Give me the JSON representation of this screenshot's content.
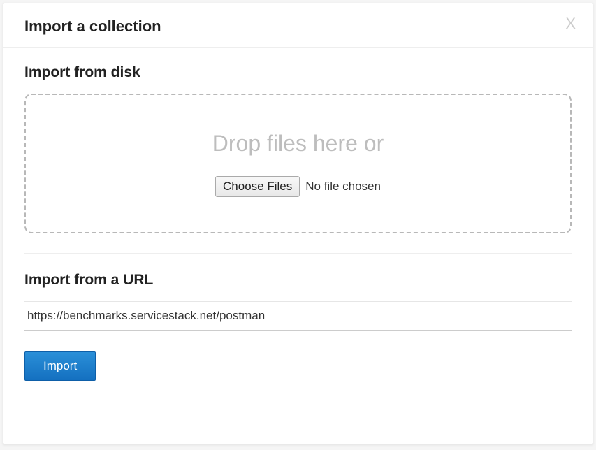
{
  "modal": {
    "title": "Import a collection",
    "close_label": "X"
  },
  "disk_section": {
    "title": "Import from disk",
    "drop_text": "Drop files here or",
    "choose_button": "Choose Files",
    "file_status": "No file chosen"
  },
  "url_section": {
    "title": "Import from a URL",
    "value": "https://benchmarks.servicestack.net/postman"
  },
  "actions": {
    "import_label": "Import"
  }
}
